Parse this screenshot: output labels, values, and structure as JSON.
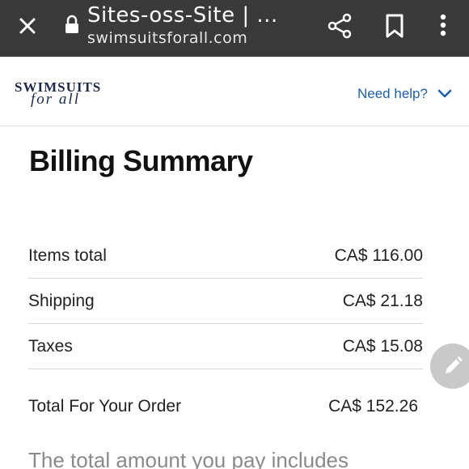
{
  "browser": {
    "title": "Sites-oss-Site | ...",
    "url": "swimsuitsforall.com",
    "icons": [
      "close-icon",
      "lock-icon",
      "share-icon",
      "bookmark-icon",
      "more-vert-icon"
    ]
  },
  "site": {
    "brand": "SWIMSUITS",
    "tagline": "for all",
    "help_label": "Need help?"
  },
  "billing": {
    "title": "Billing Summary",
    "rows": [
      {
        "label": "Items total",
        "value": "CA$ 116.00"
      },
      {
        "label": "Shipping",
        "value": "CA$ 21.18"
      },
      {
        "label": "Taxes",
        "value": "CA$ 15.08"
      }
    ],
    "total": {
      "label": "Total For Your Order",
      "value": "CA$ 152.26"
    },
    "note": "The total amount you pay includes"
  },
  "colors": {
    "topbar": "#3a3a3a",
    "link": "#1f5fa8",
    "brand": "#1c2a4a",
    "fab": "#c9c9c9"
  }
}
